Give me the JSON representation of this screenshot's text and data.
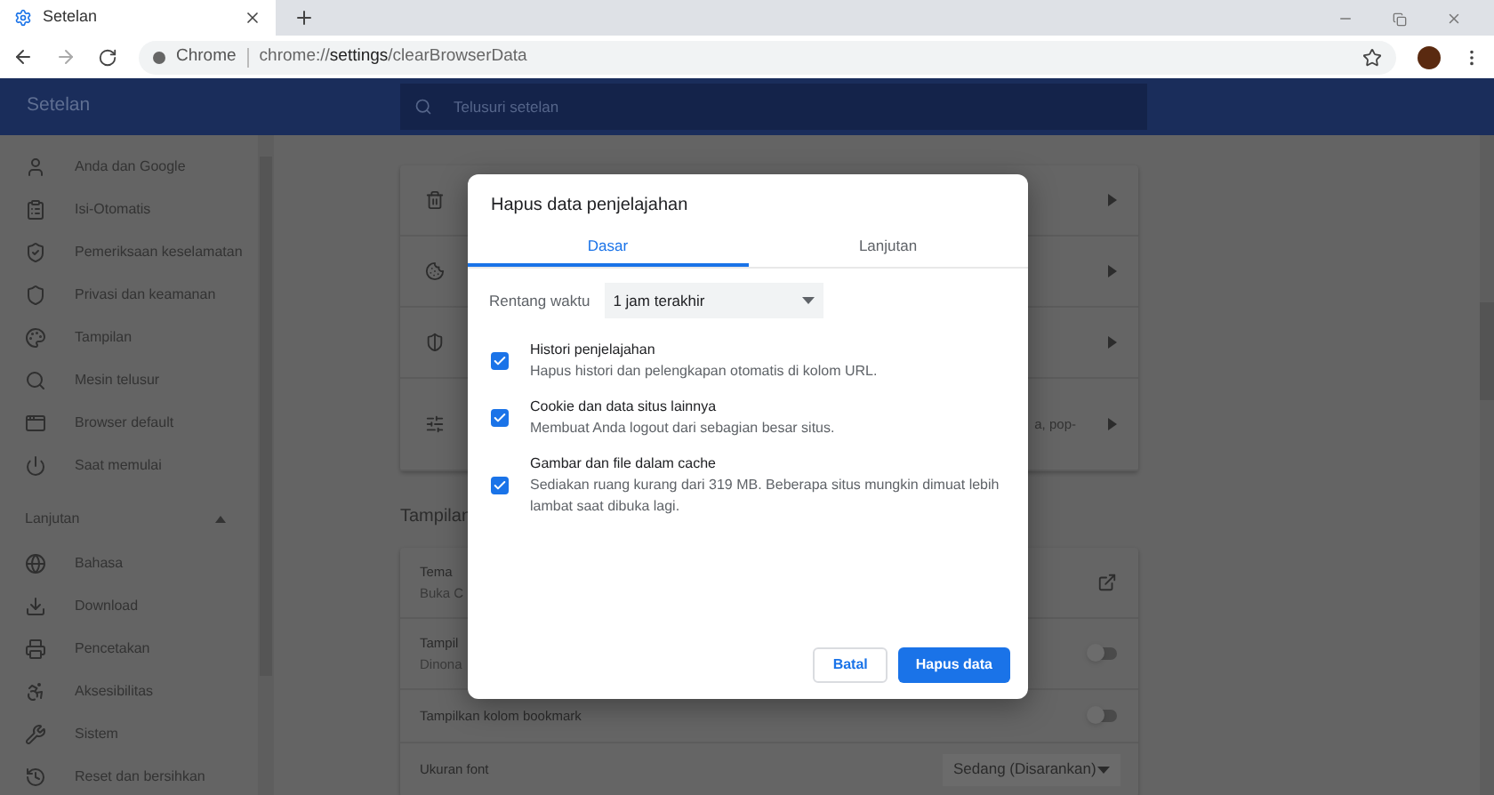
{
  "browser": {
    "tab": {
      "title": "Setelan"
    },
    "address": {
      "site_label": "Chrome",
      "url_scheme": "chrome://",
      "url_host": "settings",
      "url_path": "/clearBrowserData"
    }
  },
  "header": {
    "title": "Setelan",
    "search": {
      "placeholder": "Telusuri setelan"
    }
  },
  "sidebar": {
    "items": [
      {
        "label": "Anda dan Google"
      },
      {
        "label": "Isi-Otomatis"
      },
      {
        "label": "Pemeriksaan keselamatan"
      },
      {
        "label": "Privasi dan keamanan"
      },
      {
        "label": "Tampilan"
      },
      {
        "label": "Mesin telusur"
      },
      {
        "label": "Browser default"
      },
      {
        "label": "Saat memulai"
      }
    ],
    "section": {
      "label": "Lanjutan",
      "expanded": true
    },
    "advanced_items": [
      {
        "label": "Bahasa"
      },
      {
        "label": "Download"
      },
      {
        "label": "Pencetakan"
      },
      {
        "label": "Aksesibilitas"
      },
      {
        "label": "Sistem"
      },
      {
        "label": "Reset dan bersihkan"
      }
    ]
  },
  "privacy_card": {
    "rows": [
      {
        "kind": "link"
      },
      {
        "kind": "link"
      },
      {
        "kind": "link"
      },
      {
        "kind": "link",
        "trailing_text": "a, pop-"
      }
    ]
  },
  "appearance": {
    "heading": "Tampilan",
    "rows": [
      {
        "kind": "external",
        "title": "Tema",
        "subtitle": "Buka C"
      },
      {
        "kind": "toggle",
        "title": "Tampil",
        "subtitle": "Dinona",
        "on": false
      },
      {
        "kind": "toggle",
        "title": "Tampilkan kolom bookmark",
        "on": false
      },
      {
        "kind": "select",
        "title": "Ukuran font",
        "value": "Sedang (Disarankan)"
      }
    ]
  },
  "dialog": {
    "title": "Hapus data penjelajahan",
    "tabs": [
      {
        "label": "Dasar",
        "selected": true
      },
      {
        "label": "Lanjutan",
        "selected": false
      }
    ],
    "time_range": {
      "label": "Rentang waktu",
      "value": "1 jam terakhir"
    },
    "options": [
      {
        "title": "Histori penjelajahan",
        "description": "Hapus histori dan pelengkapan otomatis di kolom URL.",
        "checked": true
      },
      {
        "title": "Cookie dan data situs lainnya",
        "description": "Membuat Anda logout dari sebagian besar situs.",
        "checked": true
      },
      {
        "title": "Gambar dan file dalam cache",
        "description": "Sediakan ruang kurang dari 319 MB. Beberapa situs mungkin dimuat lebih lambat saat dibuka lagi.",
        "checked": true
      }
    ],
    "buttons": [
      {
        "label": "Batal",
        "kind": "secondary"
      },
      {
        "label": "Hapus data",
        "kind": "primary"
      }
    ]
  }
}
